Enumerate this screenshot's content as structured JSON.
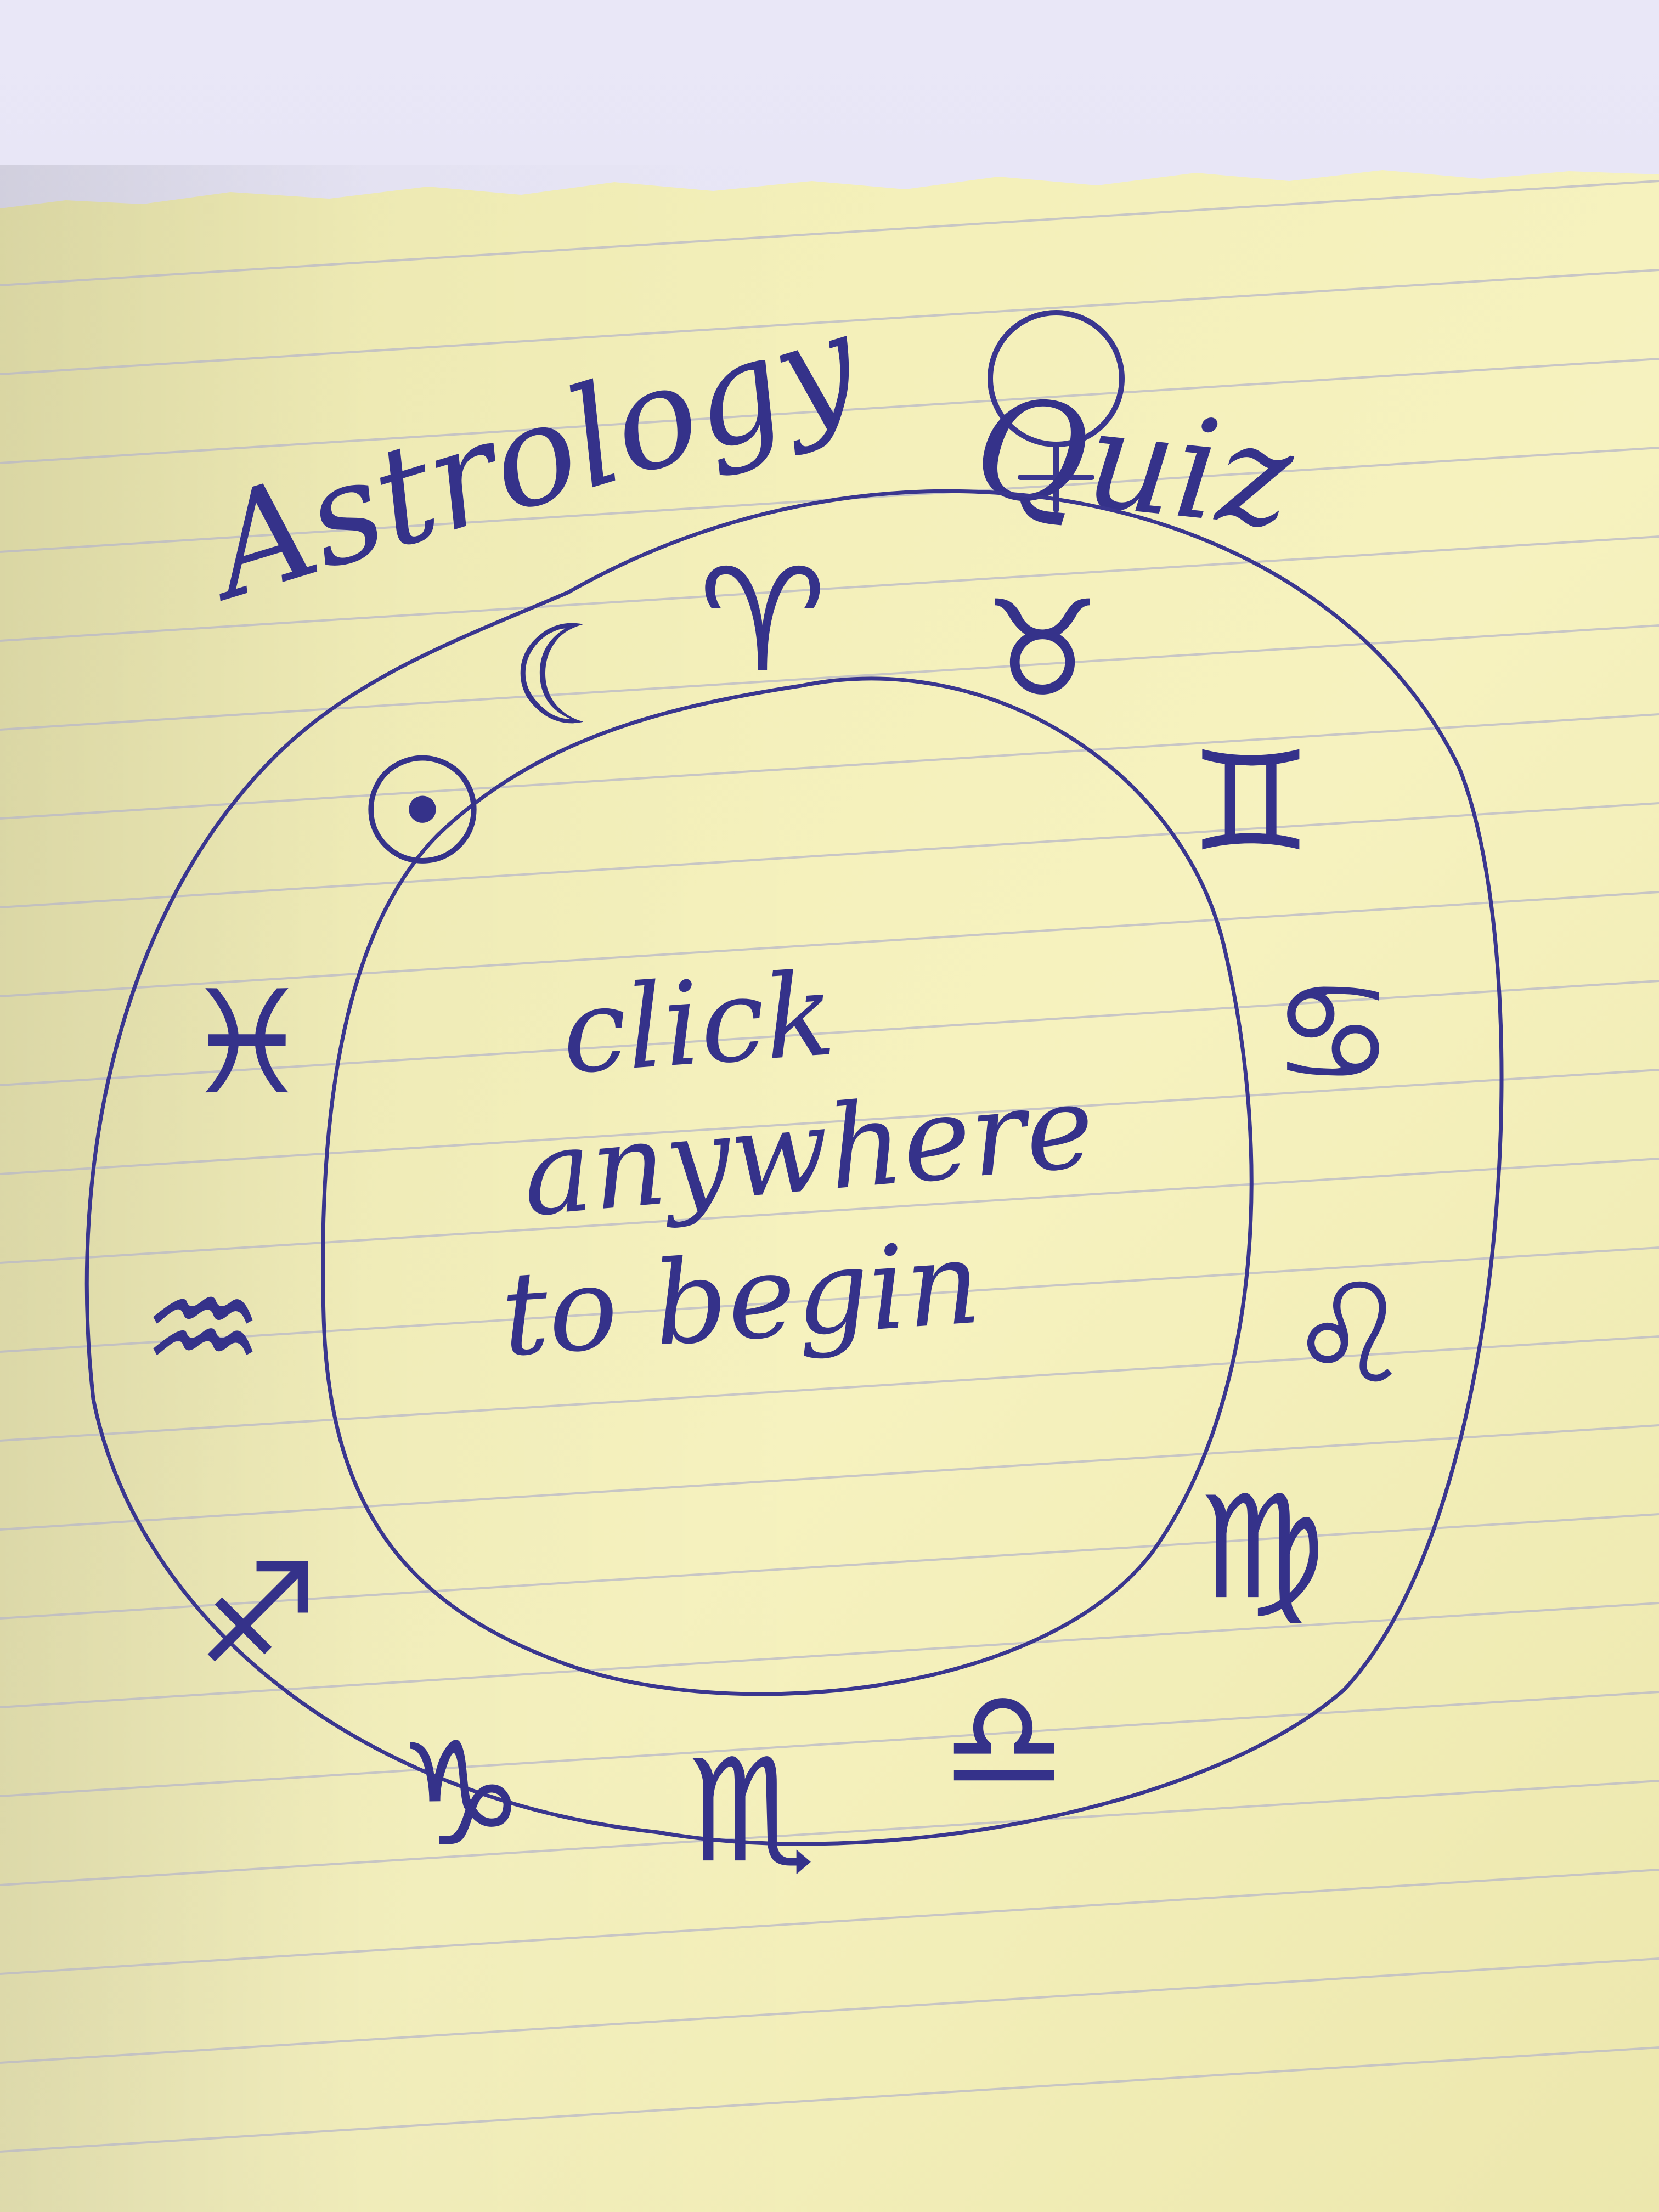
{
  "title": {
    "word1": "Astrology",
    "word2": "Quiz",
    "planet_icon": "venus-symbol-icon"
  },
  "wheel": {
    "center_lines": [
      "click",
      "anywhere",
      "to begin"
    ],
    "symbols": [
      {
        "name": "moon-icon",
        "glyph": "☾"
      },
      {
        "name": "aries-icon",
        "glyph": "♈"
      },
      {
        "name": "taurus-icon",
        "glyph": "♉"
      },
      {
        "name": "gemini-icon",
        "glyph": "♊"
      },
      {
        "name": "cancer-icon",
        "glyph": "♋"
      },
      {
        "name": "leo-icon",
        "glyph": "♌"
      },
      {
        "name": "virgo-icon",
        "glyph": "♍"
      },
      {
        "name": "libra-icon",
        "glyph": "♎"
      },
      {
        "name": "scorpio-icon",
        "glyph": "♏"
      },
      {
        "name": "capricorn-icon",
        "glyph": "♑"
      },
      {
        "name": "sagittarius-icon",
        "glyph": "♐"
      },
      {
        "name": "aquarius-icon",
        "glyph": "♒"
      },
      {
        "name": "pisces-icon",
        "glyph": "♓"
      },
      {
        "name": "sun-icon",
        "glyph": "☉"
      }
    ]
  },
  "colors": {
    "ink": "#35328a",
    "paper": "#f4f0b8",
    "rule_line": "#b9b8c8",
    "background": "#e4e2f2"
  }
}
